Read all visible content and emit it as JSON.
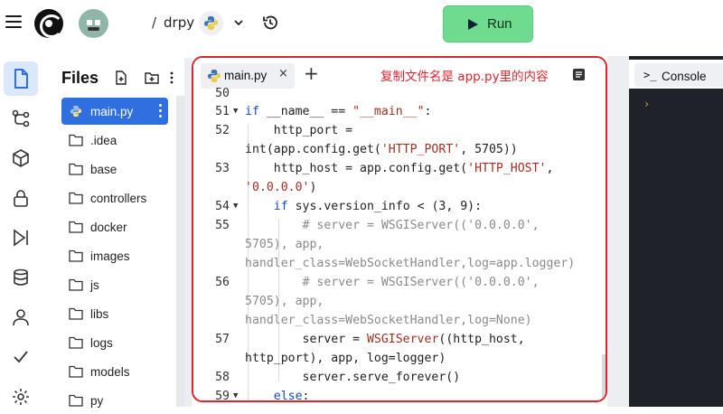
{
  "header": {
    "breadcrumb_sep": "/",
    "repl_name": "drpy",
    "run_label": "Run",
    "icons": [
      "menu-icon",
      "replit-logo",
      "user-avatar",
      "python-icon",
      "chevron-down-icon",
      "history-icon",
      "play-icon"
    ]
  },
  "rail": {
    "items": [
      "files-icon",
      "git-icon",
      "packages-icon",
      "secrets-icon",
      "debugger-icon",
      "database-icon",
      "auth-icon",
      "check-icon",
      "settings-icon"
    ]
  },
  "files": {
    "title": "Files",
    "items": [
      {
        "name": "main.py",
        "type": "python",
        "active": true
      },
      {
        "name": ".idea",
        "type": "folder"
      },
      {
        "name": "base",
        "type": "folder"
      },
      {
        "name": "controllers",
        "type": "folder"
      },
      {
        "name": "docker",
        "type": "folder"
      },
      {
        "name": "images",
        "type": "folder"
      },
      {
        "name": "js",
        "type": "folder"
      },
      {
        "name": "libs",
        "type": "folder"
      },
      {
        "name": "logs",
        "type": "folder"
      },
      {
        "name": "models",
        "type": "folder"
      },
      {
        "name": "py",
        "type": "folder"
      }
    ]
  },
  "editor": {
    "tab_label": "main.py",
    "tab_close": "×",
    "add_tab": "+",
    "annotation": "复制文件名是 app.py里的内容",
    "line_numbers": {
      "l50": "50",
      "l51": "51",
      "l52": "52",
      "l53": "53",
      "l54": "54",
      "l55": "55",
      "l56": "56",
      "l57": "57",
      "l58": "58",
      "l59": "59"
    }
  },
  "console": {
    "tab_label": "Console",
    "tab_close": "×",
    "prompt": "›",
    "icon_text": ">_"
  },
  "colors": {
    "accent": "#2f6fe0",
    "run_green": "#6edb8f",
    "annotation_red": "#d8262e",
    "console_bg": "#1f2329"
  }
}
